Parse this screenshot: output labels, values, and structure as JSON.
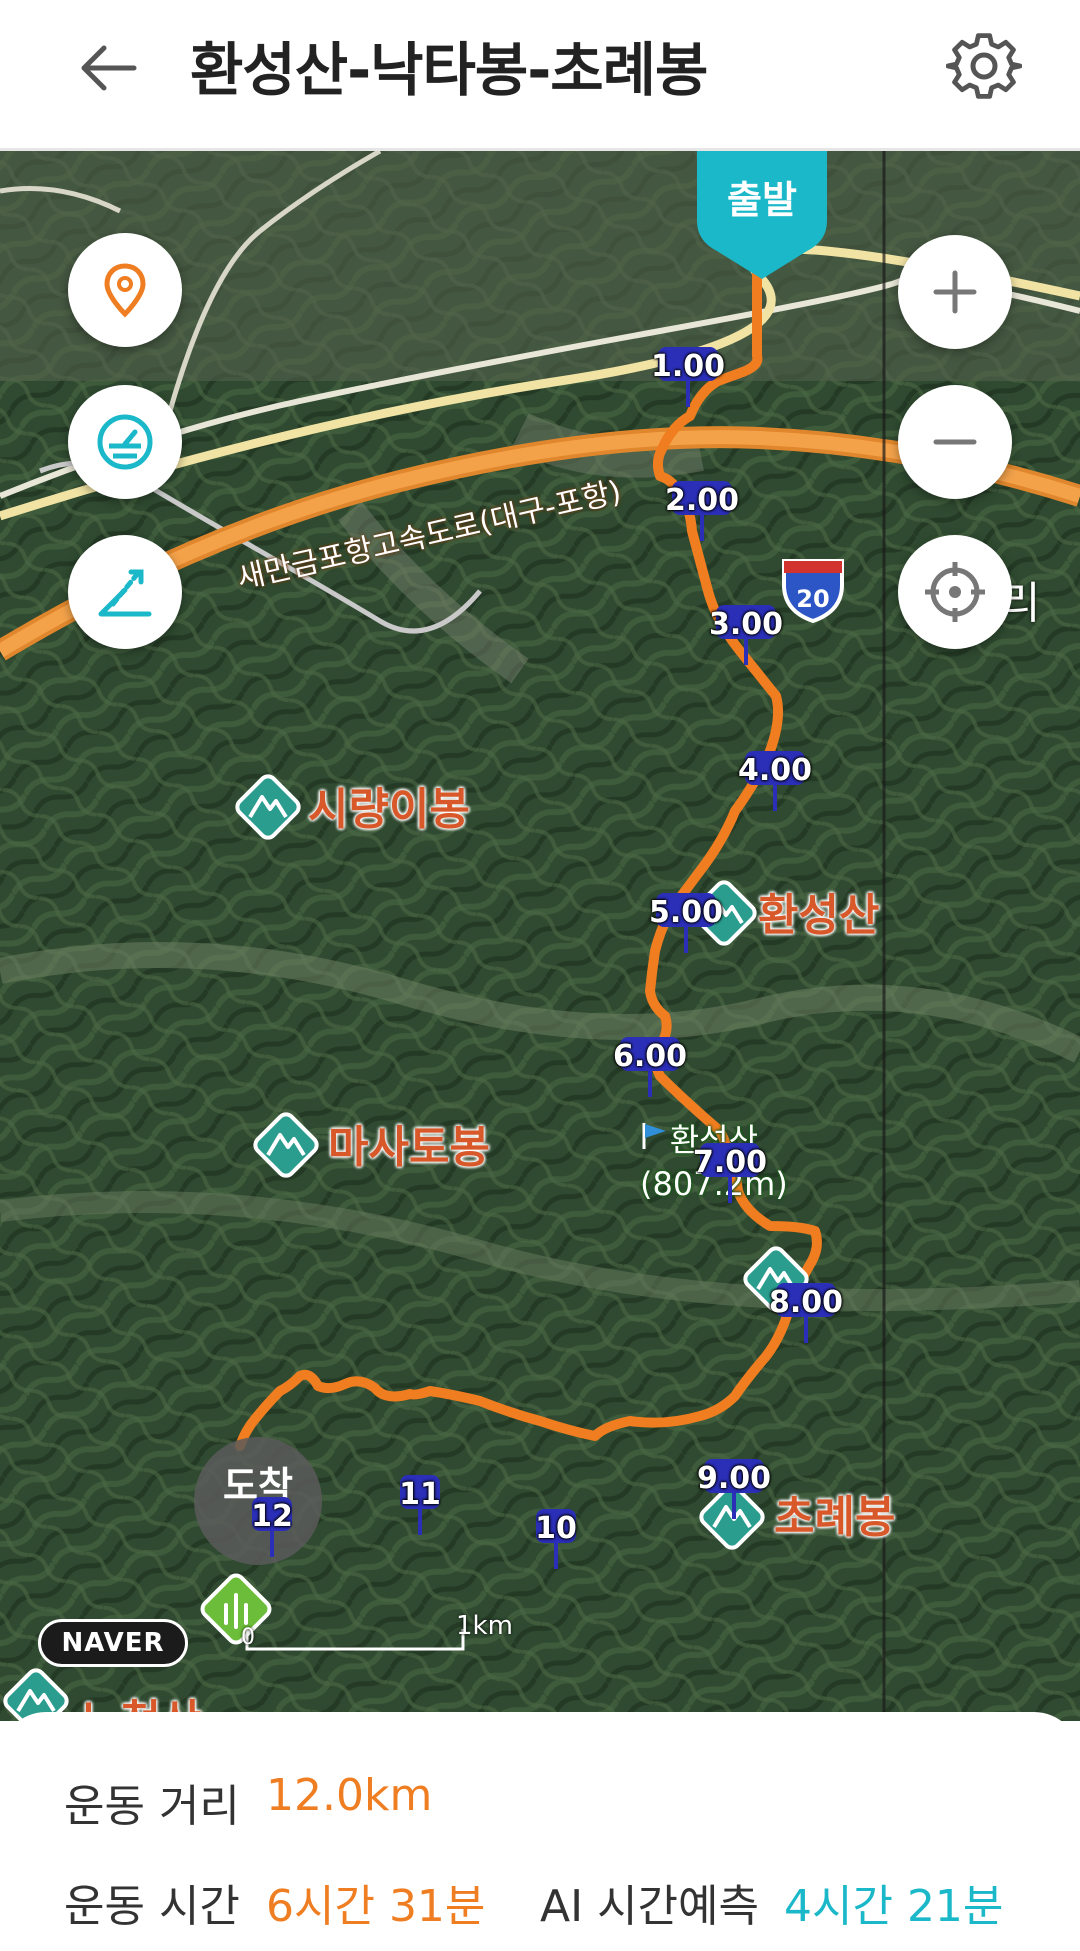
{
  "header": {
    "title": "환성산-낙타봉-초례봉",
    "back_icon": "arrow-left-icon",
    "settings_icon": "gear-icon"
  },
  "map": {
    "start_label": "출발",
    "end_label": "도착",
    "km_markers": [
      "1.00",
      "2.00",
      "3.00",
      "4.00",
      "5.00",
      "6.00",
      "7.00",
      "8.00",
      "9.00",
      "10",
      "11",
      "12"
    ],
    "peaks": {
      "siryangibong": "시량이봉",
      "hwanseongsan": "환성산",
      "masatobong": "마사토봉",
      "choryebong": "초례봉",
      "nocheolsan": "노첨산"
    },
    "summit_name": "환성산",
    "summit_elevation": "(807.2m)",
    "road_label": "새만금포항고속도로(대구-포항)",
    "highway_number": "20",
    "edge_text": "리",
    "naver_logo": "NAVER",
    "scale_zero": "0",
    "scale_label": "1km",
    "colors": {
      "route": "#f07d1f",
      "km_marker": "#2b2fb8",
      "start_pin": "#1bb8c9",
      "peak_icon": "#2a9d8f"
    }
  },
  "controls": {
    "location_icon": "location-pin-icon",
    "speed_icon": "speedometer-icon",
    "elevation_icon": "elevation-chart-icon",
    "zoom_in_icon": "plus-icon",
    "zoom_out_icon": "minus-icon",
    "gps_icon": "crosshair-icon"
  },
  "stats": {
    "distance_label": "운동 거리",
    "distance_value": "12.0km",
    "time_label": "운동 시간",
    "time_value": "6시간 31분",
    "ai_label": "AI 시간예측",
    "ai_value": "4시간 21분",
    "colors": {
      "value": "#ef7d22",
      "ai_value": "#1bb8c9"
    }
  }
}
